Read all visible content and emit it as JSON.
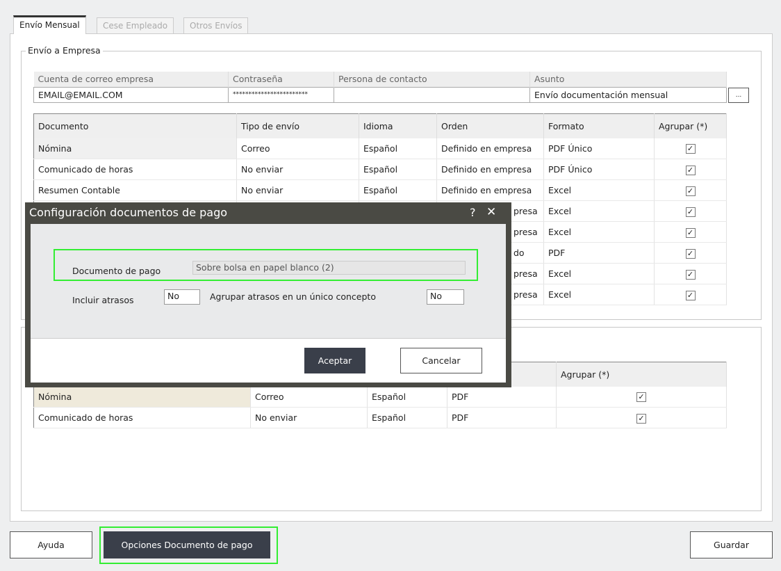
{
  "tabs": [
    {
      "label": "Envío Mensual",
      "active": true
    },
    {
      "label": "Cese Empleado"
    },
    {
      "label": "Otros Envíos"
    }
  ],
  "company": {
    "legend": "Envío a Empresa",
    "headers": [
      "Cuenta de correo empresa",
      "Contraseña",
      "Persona de contacto",
      "Asunto"
    ],
    "values": [
      "EMAIL@EMAIL.COM",
      "************************",
      "",
      "Envío documentación mensual"
    ],
    "more_label": "..."
  },
  "docs": {
    "headers": [
      "Documento",
      "Tipo de envío",
      "Idioma",
      "Orden",
      "Formato",
      "Agrupar (*)"
    ],
    "rows": [
      {
        "documento": "Nómina",
        "tipo": "Correo",
        "idioma": "Español",
        "orden": "Definido en empresa",
        "formato": "PDF Único",
        "agrupar": true
      },
      {
        "documento": "Comunicado de horas",
        "tipo": "No enviar",
        "idioma": "Español",
        "orden": "Definido en empresa",
        "formato": "PDF Único",
        "agrupar": true
      },
      {
        "documento": "Resumen Contable",
        "tipo": "No enviar",
        "idioma": "Español",
        "orden": "Definido en empresa",
        "formato": "Excel",
        "agrupar": true
      },
      {
        "documento": "",
        "tipo": "",
        "idioma": "",
        "orden": "presa",
        "formato": "Excel",
        "agrupar": true
      },
      {
        "documento": "",
        "tipo": "",
        "idioma": "",
        "orden": "presa",
        "formato": "Excel",
        "agrupar": true
      },
      {
        "documento": "",
        "tipo": "",
        "idioma": "",
        "orden": "do",
        "formato": "PDF",
        "agrupar": true
      },
      {
        "documento": "",
        "tipo": "",
        "idioma": "",
        "orden": "presa",
        "formato": "Excel",
        "agrupar": true
      },
      {
        "documento": "",
        "tipo": "",
        "idioma": "",
        "orden": "presa",
        "formato": "Excel",
        "agrupar": true
      }
    ]
  },
  "employee_docs": {
    "headers": [
      "",
      "",
      "",
      "",
      "Agrupar (*)"
    ],
    "rows": [
      {
        "documento": "Nómina",
        "tipo": "Correo",
        "idioma": "Español",
        "formato": "PDF",
        "agrupar": true
      },
      {
        "documento": "Comunicado de horas",
        "tipo": "No enviar",
        "idioma": "Español",
        "formato": "PDF",
        "agrupar": true
      }
    ]
  },
  "dialog": {
    "title": "Configuración documentos de pago",
    "help": "?",
    "close": "✕",
    "doc_label": "Documento de pago",
    "doc_value": "Sobre bolsa en papel blanco (2)",
    "atrasos_label": "Incluir atrasos",
    "atrasos_value": "No",
    "agrupar_label": "Agrupar atrasos en un único concepto",
    "agrupar_value": "No",
    "accept": "Aceptar",
    "cancel": "Cancelar"
  },
  "footer": {
    "help": "Ayuda",
    "options": "Opciones Documento de pago",
    "save": "Guardar"
  },
  "colors": {
    "highlight": "#33ee33",
    "dark_button": "#3a3f4a",
    "dialog_frame": "#4a4a44"
  }
}
